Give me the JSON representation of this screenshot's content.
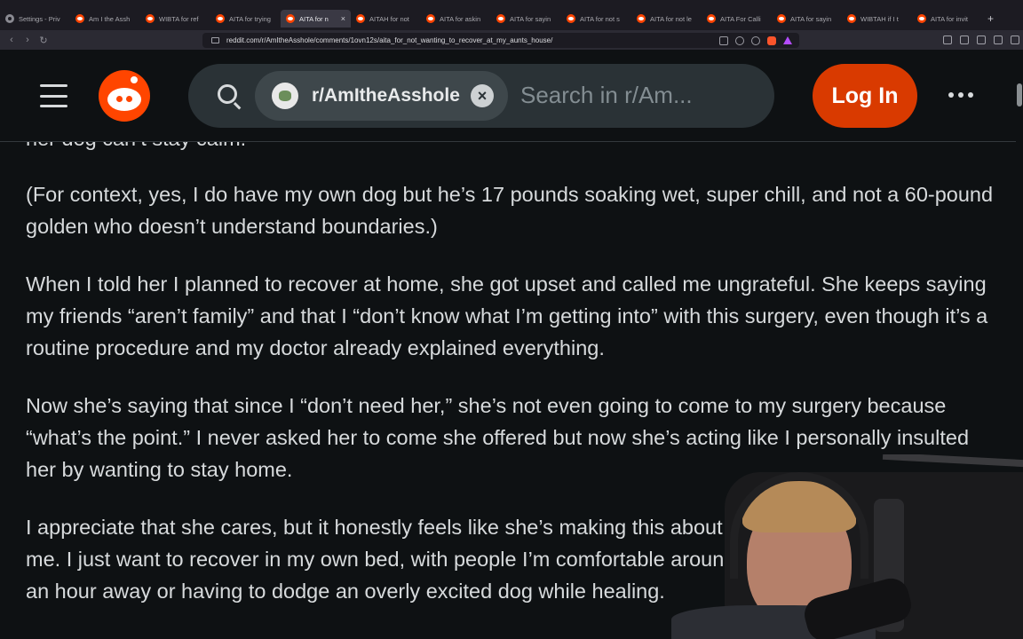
{
  "browser": {
    "tabs": [
      {
        "title": "Settings - Priv",
        "icon": "gear-icon",
        "active": false
      },
      {
        "title": "Am I the Assh",
        "icon": "reddit-icon",
        "active": false
      },
      {
        "title": "WIBTA for ref",
        "icon": "reddit-icon",
        "active": false
      },
      {
        "title": "AITA for trying",
        "icon": "reddit-icon",
        "active": false
      },
      {
        "title": "AITA for n",
        "icon": "reddit-icon",
        "active": true,
        "close": "×"
      },
      {
        "title": "AITAH for not",
        "icon": "reddit-icon",
        "active": false
      },
      {
        "title": "AITA for askin",
        "icon": "reddit-icon",
        "active": false
      },
      {
        "title": "AITA for sayin",
        "icon": "reddit-icon",
        "active": false
      },
      {
        "title": "AITA for not s",
        "icon": "reddit-icon",
        "active": false
      },
      {
        "title": "AITA for not le",
        "icon": "reddit-icon",
        "active": false
      },
      {
        "title": "AITA For Calli",
        "icon": "reddit-icon",
        "active": false
      },
      {
        "title": "AITA for sayin",
        "icon": "reddit-icon",
        "active": false
      },
      {
        "title": "WIBTAH if I t",
        "icon": "reddit-icon",
        "active": false
      },
      {
        "title": "AITA for invit",
        "icon": "reddit-icon",
        "active": false
      }
    ],
    "new_tab": "+",
    "nav": {
      "back": "‹",
      "forward": "›",
      "reload": "↻"
    },
    "url": "reddit.com/r/AmItheAsshole/comments/1ovn12s/aita_for_not_wanting_to_recover_at_my_aunts_house/"
  },
  "header": {
    "subreddit": "r/AmItheAsshole",
    "clear": "×",
    "search_placeholder": "Search in r/Am...",
    "login_label": "Log In",
    "brand_color": "#ff4500",
    "login_color": "#d93a00"
  },
  "post": {
    "partial_line": "her dog can’t stay calm.",
    "paragraphs": [
      "(For context, yes, I do have my own dog  but he’s 17 pounds soaking wet, super chill, and not a 60-pound golden who doesn’t understand boundaries.)",
      "When I told her I planned to recover at home, she got upset and called me ungrateful. She keeps saying my friends “aren’t family” and that I “don’t know what I’m getting into” with this surgery, even though it’s a routine procedure and my doctor already explained everything.",
      "Now she’s saying that since I “don’t need her,” she’s not even going to come to my surgery because “what’s the point.” I never asked her to come she offered but now she’s acting like I personally insulted her by wanting to stay home.",
      "I appreciate that she cares, but it honestly feels like she’s making this about her instead of what’s best for me. I just want to recover in my own bed, with people I’m comfortable around, and not worry about being an hour away or having to dodge an overly excited dog while healing."
    ]
  }
}
